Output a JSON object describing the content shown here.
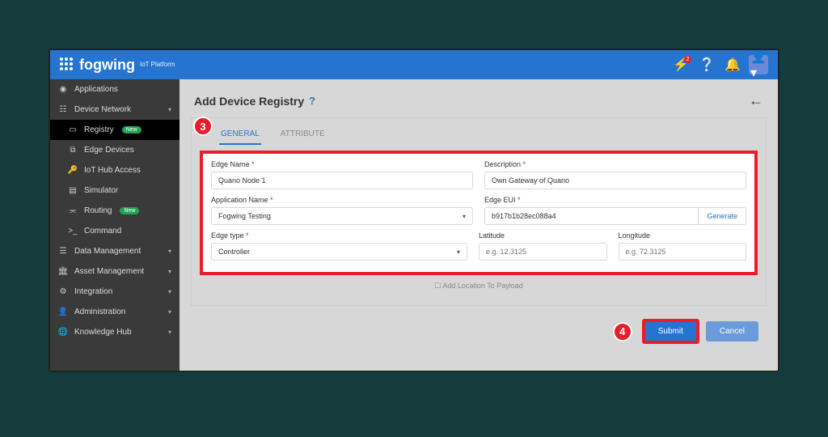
{
  "brand": {
    "name": "fogwing",
    "sub": "IoT\nPlatform"
  },
  "topbar": {
    "notif_count": "2"
  },
  "sidebar": {
    "applications": "Applications",
    "device_network": "Device Network",
    "registry": "Registry",
    "registry_badge": "New",
    "edge_devices": "Edge Devices",
    "iot_hub": "IoT Hub Access",
    "simulator": "Simulator",
    "routing": "Routing",
    "routing_badge": "New",
    "command": "Command",
    "data_mgmt": "Data Management",
    "asset_mgmt": "Asset Management",
    "integration": "Integration",
    "admin": "Administration",
    "knowledge": "Knowledge Hub"
  },
  "page": {
    "title": "Add Device Registry",
    "tabs": {
      "general": "GENERAL",
      "attribute": "ATTRIBUTE"
    }
  },
  "form": {
    "edge_name": {
      "label": "Edge Name",
      "value": "Quano Node 1"
    },
    "description": {
      "label": "Description",
      "value": "Own Gateway of Quano"
    },
    "app_name": {
      "label": "Application Name",
      "value": "Fogwing Testing"
    },
    "edge_eui": {
      "label": "Edge EUI",
      "value": "b917b1b28ec088a4",
      "generate": "Generate"
    },
    "edge_type": {
      "label": "Edge type",
      "value": "Controller"
    },
    "latitude": {
      "label": "Latitude",
      "placeholder": "e.g. 12.3125"
    },
    "longitude": {
      "label": "Longitude",
      "placeholder": "e.g. 72.3125"
    },
    "add_location": "Add Location To Payload"
  },
  "buttons": {
    "submit": "Submit",
    "cancel": "Cancel"
  },
  "markers": {
    "m3": "3",
    "m4": "4"
  }
}
